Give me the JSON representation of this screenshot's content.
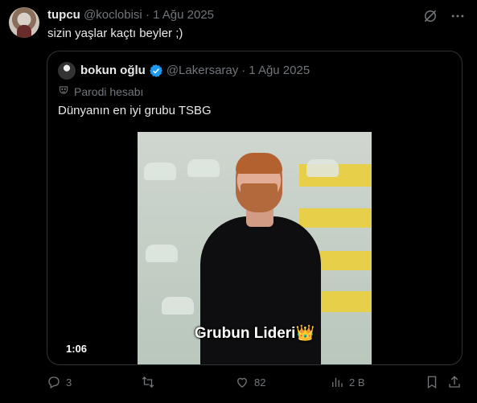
{
  "post": {
    "author_name": "tupcu",
    "author_handle": "@koclobisi",
    "separator": "·",
    "date": "1 Ağu 2025",
    "text": "sizin yaşlar kaçtı beyler ;)"
  },
  "quote": {
    "author_name": "bokun oğlu",
    "author_handle": "@Lakersaray",
    "separator": "·",
    "date": "1 Ağu 2025",
    "parody_label": "Parodi hesabı",
    "text": "Dünyanın en iyi grubu TSBG",
    "video": {
      "caption": "Grubun Lideri👑",
      "duration": "1:06"
    }
  },
  "actions": {
    "replies": "3",
    "reposts": "",
    "likes": "82",
    "views": "2 B"
  },
  "colors": {
    "background": "#000000",
    "text": "#e7e9ea",
    "muted": "#71767b",
    "border": "#2f3336",
    "verified": "#1d9bf0"
  }
}
